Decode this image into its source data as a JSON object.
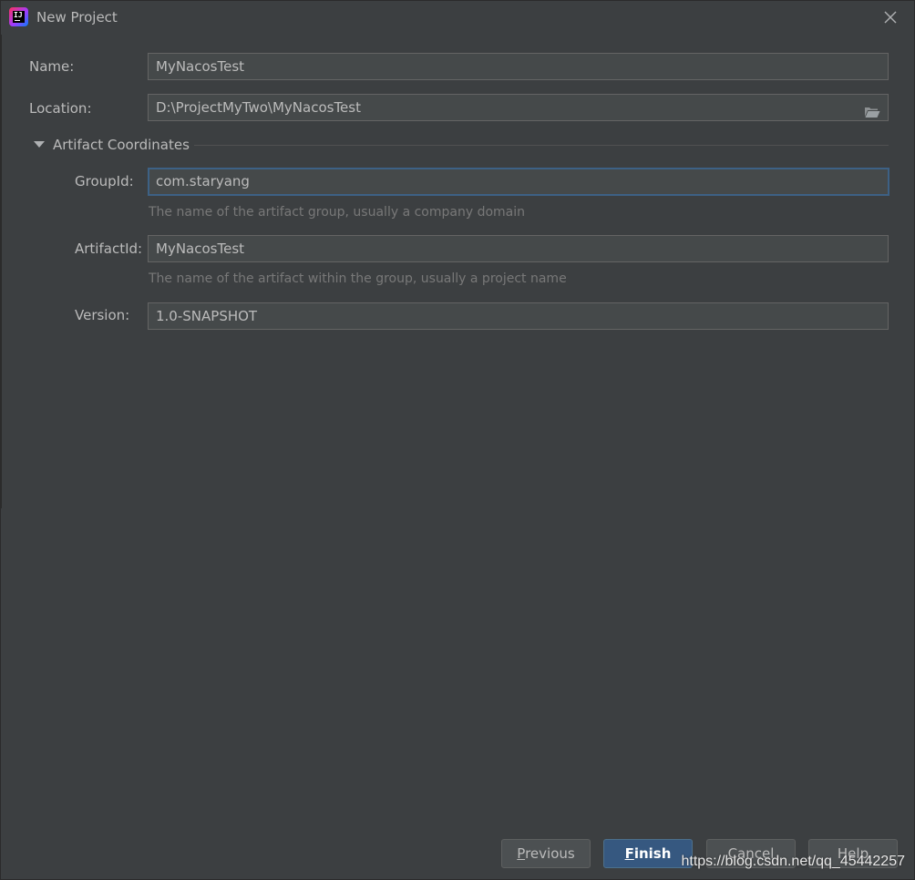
{
  "window": {
    "title": "New Project",
    "app_icon": "intellij-idea-icon",
    "close_icon": "close-icon"
  },
  "form": {
    "name": {
      "label": "Name:",
      "value": "MyNacosTest"
    },
    "location": {
      "label": "Location:",
      "value": "D:\\ProjectMyTwo\\MyNacosTest",
      "browse_icon": "folder-icon"
    },
    "artifact_section": {
      "label": "Artifact Coordinates",
      "expanded": true,
      "icon": "triangle-down-icon"
    },
    "group_id": {
      "label": "GroupId:",
      "value": "com.staryang",
      "hint": "The name of the artifact group, usually a company domain",
      "focused": true
    },
    "artifact_id": {
      "label": "ArtifactId:",
      "value": "MyNacosTest",
      "hint": "The name of the artifact within the group, usually a project name"
    },
    "version": {
      "label": "Version:",
      "value": "1.0-SNAPSHOT"
    }
  },
  "buttons": {
    "previous": {
      "mnemonic": "P",
      "rest": "revious"
    },
    "finish": {
      "mnemonic": "F",
      "rest": "inish"
    },
    "cancel": "Cancel",
    "help": "Help"
  },
  "watermark": "https://blog.csdn.net/qq_45442257",
  "colors": {
    "background": "#3c3f41",
    "field_background": "#45494a",
    "field_border": "#646464",
    "focus_border": "#3d6185",
    "primary_button": "#365880",
    "hint_text": "#787878"
  }
}
